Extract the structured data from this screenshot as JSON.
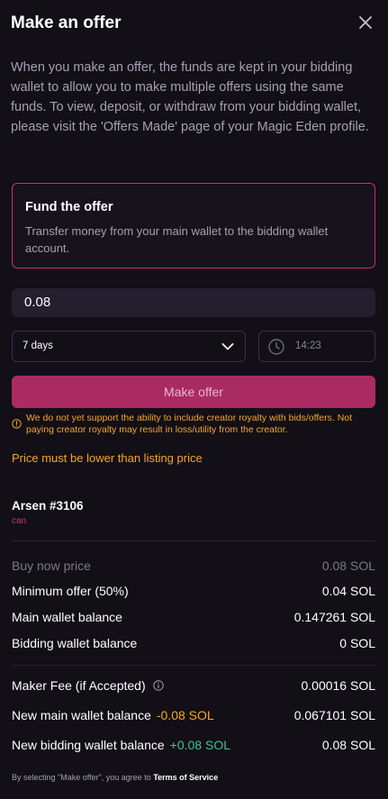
{
  "header": {
    "title": "Make an offer"
  },
  "intro": "When you make an offer, the funds are kept in your bidding wallet to allow you to make multiple offers using the same funds. To view, deposit, or withdraw from your bidding wallet, please visit the 'Offers Made' page of your Magic Eden profile.",
  "fund": {
    "title": "Fund the offer",
    "description": "Transfer money from your main wallet to the bidding wallet account."
  },
  "form": {
    "amount": "0.08",
    "duration": "7 days",
    "time": "14:23",
    "submit_label": "Make offer"
  },
  "warnings": {
    "royalty": "We do not yet support the ability to include creator royalty with bids/offers. Not paying creator royalty may result in loss/utility from the creator.",
    "price": "Price must be lower than listing price"
  },
  "nft": {
    "name": "Arsen #3106",
    "collection": "can"
  },
  "summary": [
    {
      "label": "Buy now price",
      "value": "0.08 SOL"
    },
    {
      "label": "Minimum offer (50%)",
      "value": "0.04 SOL"
    },
    {
      "label": "Main wallet balance",
      "value": "0.147261 SOL"
    },
    {
      "label": "Bidding wallet balance",
      "value": "0 SOL"
    }
  ],
  "fees": {
    "maker_fee": {
      "label": "Maker Fee (if Accepted)",
      "value": "0.00016 SOL"
    },
    "new_main": {
      "label": "New main wallet balance",
      "delta": "-0.08 SOL",
      "value": "0.067101 SOL"
    },
    "new_bidding": {
      "label": "New bidding wallet balance",
      "delta": "+0.08 SOL",
      "value": "0.08 SOL"
    }
  },
  "footer": {
    "prefix": "By selecting \"Make offer\", you agree to",
    "link": "Terms of Service"
  },
  "colors": {
    "background": "#120f17",
    "accent": "#c6336f",
    "button": "#aa2b62",
    "warning": "#f5a623",
    "positive": "#3ec48c"
  },
  "icons": [
    "close-icon",
    "chevron-down-icon",
    "clock-icon",
    "warning-icon",
    "info-icon"
  ]
}
